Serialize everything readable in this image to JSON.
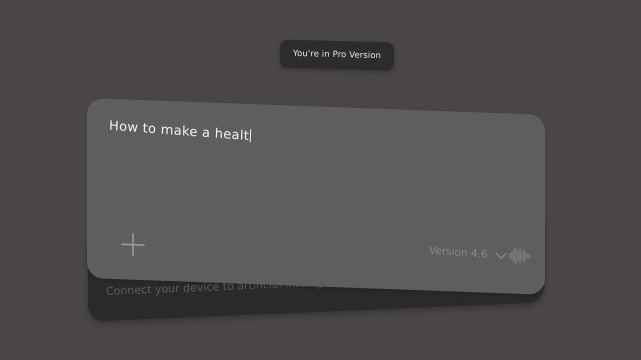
{
  "badge": {
    "label": "You're in Pro Version"
  },
  "prompt": {
    "value": "How to make a healt"
  },
  "version": {
    "label": "Version 4.6"
  },
  "footer": {
    "connect_label": "Connect your device to artificial intelligence"
  },
  "icons": {
    "add": "plus-icon",
    "version_dropdown": "chevron-down-icon",
    "voice": "waveform-icon",
    "send": "chevron-right-icon"
  },
  "colors": {
    "background": "#4a4646",
    "card": "#5f5e5e",
    "bar": "#2b2a2a",
    "badge": "#2d2c2c"
  }
}
